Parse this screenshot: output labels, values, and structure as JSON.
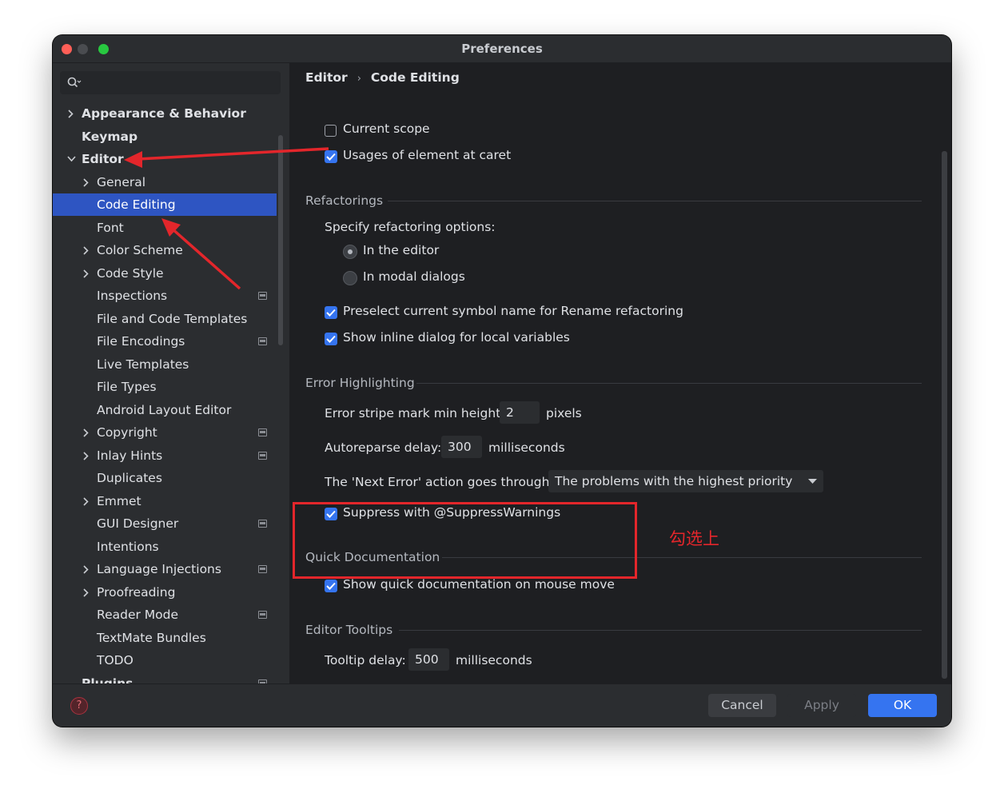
{
  "window": {
    "title": "Preferences"
  },
  "search": {
    "placeholder": ""
  },
  "sidebar": {
    "items": [
      {
        "label": "Appearance & Behavior",
        "chevron": "right",
        "bold": true
      },
      {
        "label": "Keymap",
        "bold": true
      },
      {
        "label": "Editor",
        "chevron": "down",
        "bold": true
      },
      {
        "label": "General",
        "chevron": "right"
      },
      {
        "label": "Code Editing",
        "selected": true
      },
      {
        "label": "Font"
      },
      {
        "label": "Color Scheme",
        "chevron": "right"
      },
      {
        "label": "Code Style",
        "chevron": "right"
      },
      {
        "label": "Inspections",
        "mark": true
      },
      {
        "label": "File and Code Templates"
      },
      {
        "label": "File Encodings",
        "mark": true
      },
      {
        "label": "Live Templates"
      },
      {
        "label": "File Types"
      },
      {
        "label": "Android Layout Editor"
      },
      {
        "label": "Copyright",
        "chevron": "right",
        "mark": true
      },
      {
        "label": "Inlay Hints",
        "chevron": "right",
        "mark": true
      },
      {
        "label": "Duplicates"
      },
      {
        "label": "Emmet",
        "chevron": "right"
      },
      {
        "label": "GUI Designer",
        "mark": true
      },
      {
        "label": "Intentions"
      },
      {
        "label": "Language Injections",
        "chevron": "right",
        "mark": true
      },
      {
        "label": "Proofreading",
        "chevron": "right"
      },
      {
        "label": "Reader Mode",
        "mark": true
      },
      {
        "label": "TextMate Bundles"
      },
      {
        "label": "TODO"
      },
      {
        "label": "Plugins",
        "bold": true,
        "mark": true
      }
    ]
  },
  "breadcrumb": {
    "parent": "Editor",
    "current": "Code Editing"
  },
  "content": {
    "current_scope": "Current scope",
    "usages_caret": "Usages of element at caret",
    "refactorings": {
      "title": "Refactorings",
      "specify": "Specify refactoring options:",
      "in_editor": "In the editor",
      "in_modal": "In modal dialogs",
      "preselect": "Preselect current symbol name for Rename refactoring",
      "inline_dialog": "Show inline dialog for local variables"
    },
    "error_highlighting": {
      "title": "Error Highlighting",
      "stripe_label": "Error stripe mark min height:",
      "stripe_value": "2",
      "stripe_unit": "pixels",
      "autoreparse_label": "Autoreparse delay:",
      "autoreparse_value": "300",
      "autoreparse_unit": "milliseconds",
      "next_error_label": "The 'Next Error' action goes through:",
      "next_error_value": "The problems with the highest priority",
      "suppress": "Suppress with @SuppressWarnings"
    },
    "quick_doc": {
      "title": "Quick Documentation",
      "show_on_mouse": "Show quick documentation on mouse move"
    },
    "tooltips": {
      "title": "Editor Tooltips",
      "delay_label": "Tooltip delay:",
      "delay_value": "500",
      "delay_unit": "milliseconds"
    }
  },
  "footer": {
    "cancel": "Cancel",
    "apply": "Apply",
    "ok": "OK"
  },
  "annotation": {
    "note": "勾选上",
    "color": "#e3262b"
  },
  "colors": {
    "accent": "#3574f0",
    "selection": "#2e55c2",
    "annotation": "#e3262b"
  }
}
